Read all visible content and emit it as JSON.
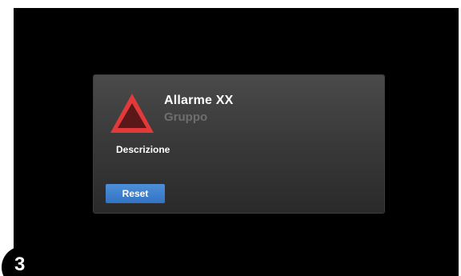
{
  "alarm": {
    "title": "Allarme XX",
    "group": "Gruppo",
    "description": "Descrizione",
    "reset_label": "Reset",
    "icon": "warning-triangle-icon"
  },
  "step_badge": "3",
  "colors": {
    "screen_background": "#000000",
    "dialog_background": "#3a3a3a",
    "warning_red": "#e23a3a",
    "button_blue": "#3d7fcf",
    "group_text": "#6e6e6e"
  }
}
